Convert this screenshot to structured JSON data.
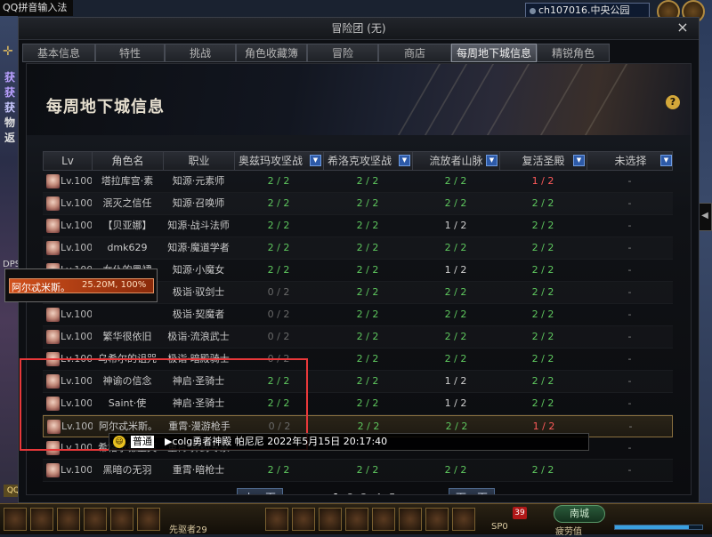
{
  "ime": {
    "label": "QQ拼音输入法"
  },
  "side_chars": [
    "获",
    "获",
    "获",
    "物",
    "返"
  ],
  "dps_label": "DPS",
  "status_label": "QQ",
  "hud_top": {
    "server": "ch107016.中央公园"
  },
  "window": {
    "title": "冒险团 (无)",
    "close": "×",
    "tabs": [
      {
        "label": "基本信息"
      },
      {
        "label": "特性"
      },
      {
        "label": "挑战"
      },
      {
        "label": "角色收藏簿"
      },
      {
        "label": "冒险"
      },
      {
        "label": "商店"
      },
      {
        "label": "每周地下城信息"
      },
      {
        "label": "精锐角色"
      }
    ],
    "active_tab": 6,
    "content_title": "每周地下城信息",
    "help": "?"
  },
  "table": {
    "headers": [
      "Lv",
      "角色名",
      "职业",
      "奥兹玛攻坚战",
      "希洛克攻坚战",
      "流放者山脉",
      "复活圣殿",
      "未选择"
    ],
    "dropdown_icon": "▼",
    "rows": [
      {
        "lv": "Lv.100",
        "name": "塔拉库宫·素",
        "job": "知源·元素师",
        "c1": "2 / 2",
        "c2": "2 / 2",
        "c3": "2 / 2",
        "c4": "1 / 2",
        "c5": "-"
      },
      {
        "lv": "Lv.100",
        "name": "泯灭之信任",
        "job": "知源·召唤师",
        "c1": "2 / 2",
        "c2": "2 / 2",
        "c3": "2 / 2",
        "c4": "2 / 2",
        "c5": "-"
      },
      {
        "lv": "Lv.100",
        "name": "【贝亚娜】",
        "job": "知源·战斗法师",
        "c1": "2 / 2",
        "c2": "2 / 2",
        "c3": "1 / 2",
        "c4": "2 / 2",
        "c5": "-"
      },
      {
        "lv": "Lv.100",
        "name": "dmk629",
        "job": "知源·魔道学者",
        "c1": "2 / 2",
        "c2": "2 / 2",
        "c3": "2 / 2",
        "c4": "2 / 2",
        "c5": "-"
      },
      {
        "lv": "Lv.100",
        "name": "女仆的黑裙",
        "job": "知源·小魔女",
        "c1": "2 / 2",
        "c2": "2 / 2",
        "c3": "1 / 2",
        "c4": "2 / 2",
        "c5": "-"
      },
      {
        "lv": "Lv.100",
        "name": "",
        "job": "极诣·驭剑士",
        "c1": "0 / 2",
        "c2": "2 / 2",
        "c3": "2 / 2",
        "c4": "2 / 2",
        "c5": "-"
      },
      {
        "lv": "Lv.100",
        "name": "",
        "job": "极诣·契魔者",
        "c1": "0 / 2",
        "c2": "2 / 2",
        "c3": "2 / 2",
        "c4": "2 / 2",
        "c5": "-"
      },
      {
        "lv": "Lv.100",
        "name": "繁华很依旧",
        "job": "极诣·流浪武士",
        "c1": "0 / 2",
        "c2": "2 / 2",
        "c3": "2 / 2",
        "c4": "2 / 2",
        "c5": "-"
      },
      {
        "lv": "Lv.100",
        "name": "乌希尔的诅咒",
        "job": "极诣·暗殿骑士",
        "c1": "0 / 2",
        "c2": "2 / 2",
        "c3": "2 / 2",
        "c4": "2 / 2",
        "c5": "-"
      },
      {
        "lv": "Lv.100",
        "name": "神谕の信念",
        "job": "神启·圣骑士",
        "c1": "2 / 2",
        "c2": "2 / 2",
        "c3": "1 / 2",
        "c4": "2 / 2",
        "c5": "-"
      },
      {
        "lv": "Lv.100",
        "name": "Saint·使",
        "job": "神启·圣骑士",
        "c1": "2 / 2",
        "c2": "2 / 2",
        "c3": "1 / 2",
        "c4": "2 / 2",
        "c5": "-"
      },
      {
        "lv": "Lv.100",
        "name": "阿尔忒米斯。",
        "job": "重霄·漫游枪手",
        "c1": "0 / 2",
        "c2": "2 / 2",
        "c3": "2 / 2",
        "c4": "1 / 2",
        "c5": "-"
      },
      {
        "lv": "Lv.100",
        "name": "希格尔德里芙",
        "job": "重霄·弹药专家",
        "c1": "",
        "c2": "",
        "c3": "",
        "c4": "",
        "c5": "-"
      },
      {
        "lv": "Lv.100",
        "name": "黑暗の无羽",
        "job": "重霄·暗枪士",
        "c1": "2 / 2",
        "c2": "2 / 2",
        "c3": "2 / 2",
        "c4": "2 / 2",
        "c5": "-"
      }
    ],
    "selected_row": 11
  },
  "pagination": {
    "prev": "上一页",
    "next": "下一页",
    "pages": [
      "1",
      "2",
      "3",
      "4",
      "5"
    ],
    "current": 0
  },
  "dps_panel": {
    "name": "阿尔忒米斯。",
    "value": "25.20M, 100%"
  },
  "chat": {
    "emoji": "😃",
    "channel": "普通",
    "message": "▶colg勇者神殿 帕尼尼 2022年5月15日 20:17:40"
  },
  "hud_bottom": {
    "level_text": "先驱者29",
    "town": "南城",
    "exp_label": "疲劳值",
    "sp": "SP0",
    "badge": "39",
    "exp_fraction": 0.85
  },
  "colors": {
    "ok": "#5ec85e",
    "partial": "#ff5a5a",
    "zero": "#6a6a6a",
    "highlight": "#e8383a",
    "accent": "#2d5aa8"
  }
}
